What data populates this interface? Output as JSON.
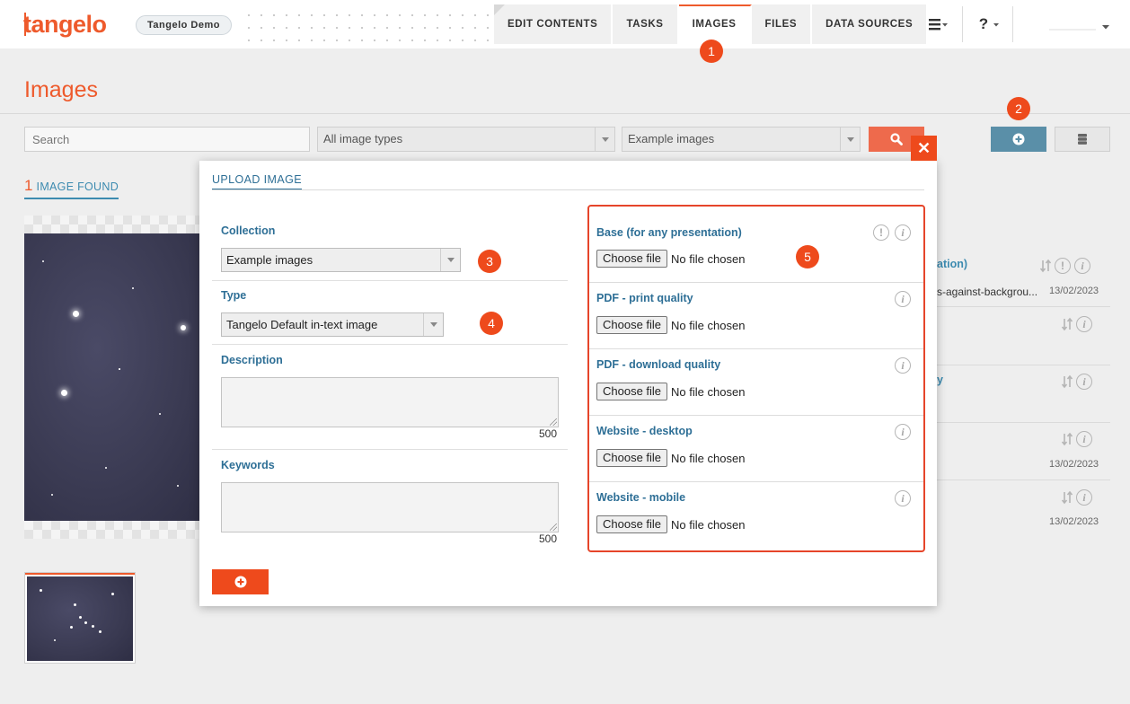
{
  "app": {
    "logo": "tangelo",
    "project": "Tangelo Demo"
  },
  "nav": {
    "tabs": [
      {
        "label": "EDIT CONTENTS",
        "active": false
      },
      {
        "label": "TASKS",
        "active": false
      },
      {
        "label": "IMAGES",
        "active": true
      },
      {
        "label": "FILES",
        "active": false
      },
      {
        "label": "DATA SOURCES",
        "active": false
      }
    ],
    "help_label": "?"
  },
  "page": {
    "title": "Images"
  },
  "filters": {
    "search_placeholder": "Search",
    "type_select": "All image types",
    "collection_select": "Example images"
  },
  "results": {
    "count": "1",
    "label": "IMAGE FOUND"
  },
  "background_list": {
    "link_fragment": "ation)",
    "filename_fragment": "s-against-backgrou...",
    "date": "13/02/2023",
    "link_fragment_2": "y",
    "dates": [
      "13/02/2023",
      "13/02/2023"
    ]
  },
  "modal": {
    "tab": "UPLOAD IMAGE",
    "close_glyph": "✕",
    "collection_label": "Collection",
    "collection_value": "Example images",
    "type_label": "Type",
    "type_value": "Tangelo Default in-text image",
    "description_label": "Description",
    "description_counter": "500",
    "keywords_label": "Keywords",
    "keywords_counter": "500",
    "uploads": [
      {
        "label": "Base (for any presentation)",
        "button": "Choose file",
        "status": "No file chosen"
      },
      {
        "label": "PDF - print quality",
        "button": "Choose file",
        "status": "No file chosen"
      },
      {
        "label": "PDF - download quality",
        "button": "Choose file",
        "status": "No file chosen"
      },
      {
        "label": "Website - desktop",
        "button": "Choose file",
        "status": "No file chosen"
      },
      {
        "label": "Website - mobile",
        "button": "Choose file",
        "status": "No file chosen"
      }
    ]
  },
  "annotations": [
    "1",
    "2",
    "3",
    "4",
    "5"
  ],
  "colors": {
    "brand": "#ee5a2c",
    "accent": "#2e6f96",
    "add_button": "#5a8fa8",
    "annotation": "#ee4a1c"
  }
}
